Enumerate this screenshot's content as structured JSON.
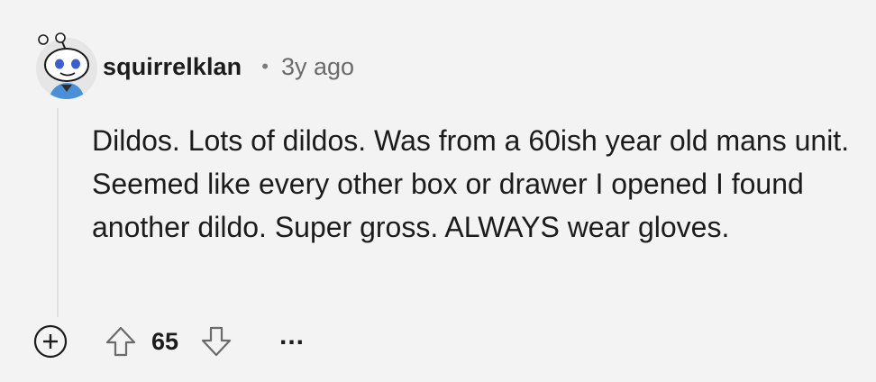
{
  "comment": {
    "author": "squirrelklan",
    "separator": "•",
    "timestamp": "3y ago",
    "body": "Dildos. Lots of dildos. Was from a 60ish year old mans unit. Seemed like every other box or drawer I opened I found another dildo. Super gross. ALWAYS wear gloves.",
    "score": "65",
    "more_label": "..."
  },
  "icons": {
    "avatar": "snoo-avatar-icon",
    "expand": "plus-circle-icon",
    "upvote": "upvote-arrow-icon",
    "downvote": "downvote-arrow-icon"
  },
  "colors": {
    "background": "#f3f3f3",
    "text": "#1c1c1c",
    "muted": "#6b6b6b",
    "thread_line": "#e0e0e0"
  }
}
